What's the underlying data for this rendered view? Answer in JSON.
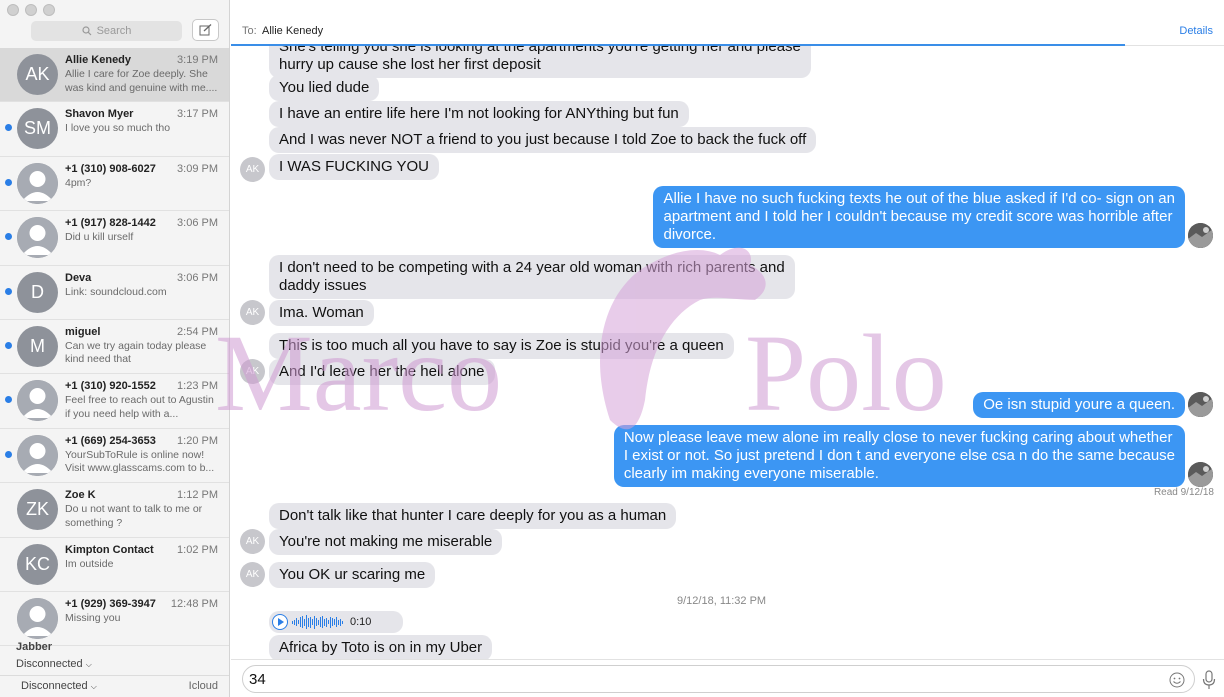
{
  "sidebar": {
    "search_placeholder": "Search",
    "compose_icon": "compose-icon",
    "conversations": [
      {
        "initials": "AK",
        "name": "Allie Kenedy",
        "time": "3:19 PM",
        "preview": "Allie I care for Zoe deeply. She was kind and genuine with me....",
        "unread": false,
        "selected": true,
        "photo": false
      },
      {
        "initials": "SM",
        "name": "Shavon Myer",
        "time": "3:17 PM",
        "preview": "I love you so much tho",
        "unread": true,
        "selected": false,
        "photo": false
      },
      {
        "initials": "",
        "name": "+1 (310) 908-6027",
        "time": "3:09 PM",
        "preview": "4pm?",
        "unread": true,
        "selected": false,
        "photo": true
      },
      {
        "initials": "",
        "name": "+1 (917) 828-1442",
        "time": "3:06 PM",
        "preview": "Did u kill urself",
        "unread": true,
        "selected": false,
        "photo": true
      },
      {
        "initials": "D",
        "name": "Deva",
        "time": "3:06 PM",
        "preview": "Link: soundcloud.com",
        "unread": true,
        "selected": false,
        "photo": false
      },
      {
        "initials": "M",
        "name": "miguel",
        "time": "2:54 PM",
        "preview": "Can we try again today please kind need that",
        "unread": true,
        "selected": false,
        "photo": false
      },
      {
        "initials": "",
        "name": "+1 (310) 920-1552",
        "time": "1:23 PM",
        "preview": "Feel free to reach out to Agustin if you need help with a...",
        "unread": true,
        "selected": false,
        "photo": true
      },
      {
        "initials": "",
        "name": "+1 (669) 254-3653",
        "time": "1:20 PM",
        "preview": "YourSubToRule is online now! Visit www.glasscams.com to b...",
        "unread": true,
        "selected": false,
        "photo": true
      },
      {
        "initials": "ZK",
        "name": "Zoe K",
        "time": "1:12 PM",
        "preview": "Do u not want to talk to me or something ?",
        "unread": false,
        "selected": false,
        "photo": false
      },
      {
        "initials": "KC",
        "name": "Kimpton Contact",
        "time": "1:02 PM",
        "preview": "Im outside",
        "unread": false,
        "selected": false,
        "photo": false
      },
      {
        "initials": "",
        "name": "+1 (929) 369-3947",
        "time": "12:48 PM",
        "preview": "Missing you",
        "unread": false,
        "selected": false,
        "photo": true
      }
    ],
    "account_name": "Jabber",
    "account_status": "Disconnected",
    "bottom_status": "Disconnected",
    "bottom_account": "Icloud"
  },
  "header": {
    "to_label": "To:",
    "recipient": "Allie Kenedy",
    "details_label": "Details"
  },
  "messages": [
    {
      "side": "left",
      "lines": [
        "She's telling you she is looking at the apartments you're getting her and please",
        "hurry up cause she lost her first deposit"
      ],
      "avatar": ""
    },
    {
      "side": "left",
      "lines": [
        "You lied dude"
      ],
      "avatar": ""
    },
    {
      "side": "left",
      "lines": [
        "I have an entire life here I'm not looking for ANYthing but fun"
      ],
      "avatar": ""
    },
    {
      "side": "left",
      "lines": [
        "And I was never NOT a friend to you just because I told Zoe to back the fuck off"
      ],
      "avatar": ""
    },
    {
      "side": "left",
      "lines": [
        "I WAS FUCKING YOU"
      ],
      "avatar": "AK"
    },
    {
      "side": "right",
      "lines": [
        "Allie I have no such fucking texts he out of the blue asked if I'd co- sign on an",
        "apartment and I told her I couldn't because my credit score was horrible after",
        "divorce."
      ],
      "avatar": "photo"
    },
    {
      "side": "left",
      "lines": [
        "I don't need to be competing with a 24 year old woman with rich parents and",
        "daddy issues"
      ],
      "avatar": ""
    },
    {
      "side": "left",
      "lines": [
        "Ima. Woman"
      ],
      "avatar": "AK"
    },
    {
      "side": "left",
      "lines": [
        "This is too much all you have to say is Zoe is stupid you're a queen"
      ],
      "avatar": ""
    },
    {
      "side": "left",
      "lines": [
        "And I'd leave her the hell alone"
      ],
      "avatar": "AK"
    },
    {
      "side": "right",
      "lines": [
        "Oe isn stupid youre a queen."
      ],
      "avatar": "photo"
    },
    {
      "side": "right",
      "lines": [
        "Now please leave mew alone im really close to never fucking caring about whether",
        "I exist or not. So just pretend I don t and everyone else csa n do the same because",
        "clearly im making everyone miserable."
      ],
      "avatar": "photo"
    },
    {
      "side": "left",
      "lines": [
        "Don't talk like that hunter I care deeply for you as a human"
      ],
      "avatar": ""
    },
    {
      "side": "left",
      "lines": [
        "You're not making me miserable"
      ],
      "avatar": "AK"
    },
    {
      "side": "left",
      "lines": [
        "You OK ur scaring me"
      ],
      "avatar": "AK"
    },
    {
      "side": "left",
      "lines": [
        "Africa by Toto is on in my Uber"
      ],
      "avatar": ""
    }
  ],
  "read_receipt": "Read 9/12/18",
  "timestamp": "9/12/18, 11:32 PM",
  "audio": {
    "duration": "0:10",
    "icon": "play-icon"
  },
  "composer": {
    "text": "34",
    "emoji_icon": "emoji-icon",
    "mic_icon": "microphone-icon"
  },
  "watermark": {
    "text": "Marco Polo",
    "color": "#c98bc9"
  }
}
